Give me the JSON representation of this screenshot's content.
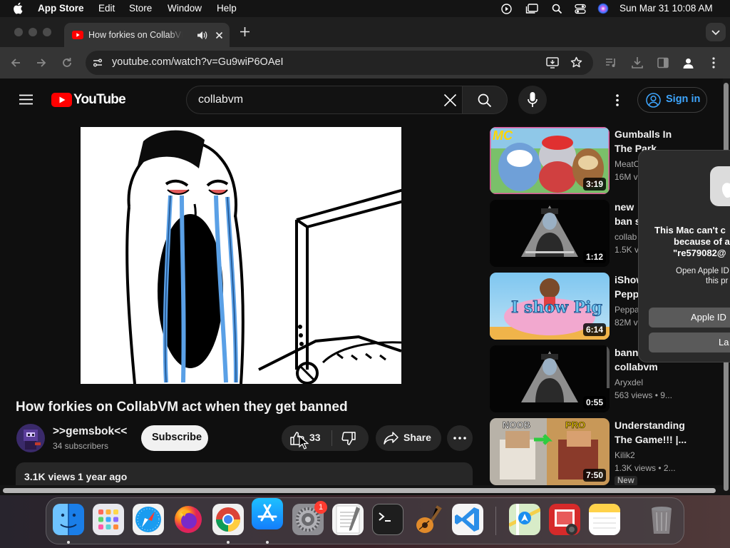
{
  "menubar": {
    "app": "App Store",
    "items": [
      "Edit",
      "Store",
      "Window",
      "Help"
    ],
    "clock": "Sun Mar 31  10:08 AM"
  },
  "browser": {
    "tab_title": "How forkies on CollabVM a",
    "url": "youtube.com/watch?v=Gu9wiP6OAeI"
  },
  "youtube": {
    "logo_text": "YouTube",
    "search_value": "collabvm",
    "sign_in": "Sign in",
    "video": {
      "title": "How forkies on CollabVM act when they get banned",
      "channel": ">>gemsbok<<",
      "subscribers": "34 subscribers",
      "subscribe": "Subscribe",
      "likes": "33",
      "share": "Share",
      "views": "3.1K views",
      "age": "1 year ago"
    },
    "related": [
      {
        "title1": "Gumballs In",
        "title2": "The Park",
        "meta1": "MeatC",
        "meta2": "16M v",
        "duration": "3:19"
      },
      {
        "title1": "new",
        "title2": "ban s",
        "meta1": "collab",
        "meta2": "1.5K v",
        "duration": "1:12"
      },
      {
        "title1": "iShow",
        "title2": "Pepp",
        "meta1": "Peppa",
        "meta2": "82M v",
        "duration": "6:14"
      },
      {
        "title1": "bann",
        "title2": "collabvm",
        "meta1": "Aryxdel",
        "meta2": "563 views  •  9...",
        "duration": "0:55"
      },
      {
        "title1": "Understanding",
        "title2": "The Game!!! |...",
        "meta1": "Kilik2",
        "meta2": "1.3K views  •  2...",
        "duration": "7:50",
        "badge": "New"
      }
    ],
    "thumb_texts": {
      "mc": "MC",
      "ishow": "I show Pig",
      "noob": "NOOB",
      "pro": "PRO"
    }
  },
  "dialog": {
    "line1": "This Mac can't c",
    "line2": "because of a",
    "line3": "\"re579082@",
    "line4": "Open Apple ID",
    "line5": "this pr",
    "button1": "Apple ID",
    "button2": "La"
  },
  "dock": {
    "settings_badge": "1",
    "apps": [
      "finder-icon",
      "launchpad-icon",
      "safari-icon",
      "firefox-icon",
      "chrome-icon",
      "app-store-icon",
      "system-settings-icon",
      "textedit-icon",
      "terminal-icon",
      "garageband-icon",
      "vscode-icon",
      "maps-icon",
      "photo-booth-icon",
      "notes-icon",
      "trash-icon"
    ]
  },
  "colors": {
    "youtube_red": "#ff0000",
    "link_blue": "#3ea6ff",
    "dock_blue": "#147efb"
  }
}
